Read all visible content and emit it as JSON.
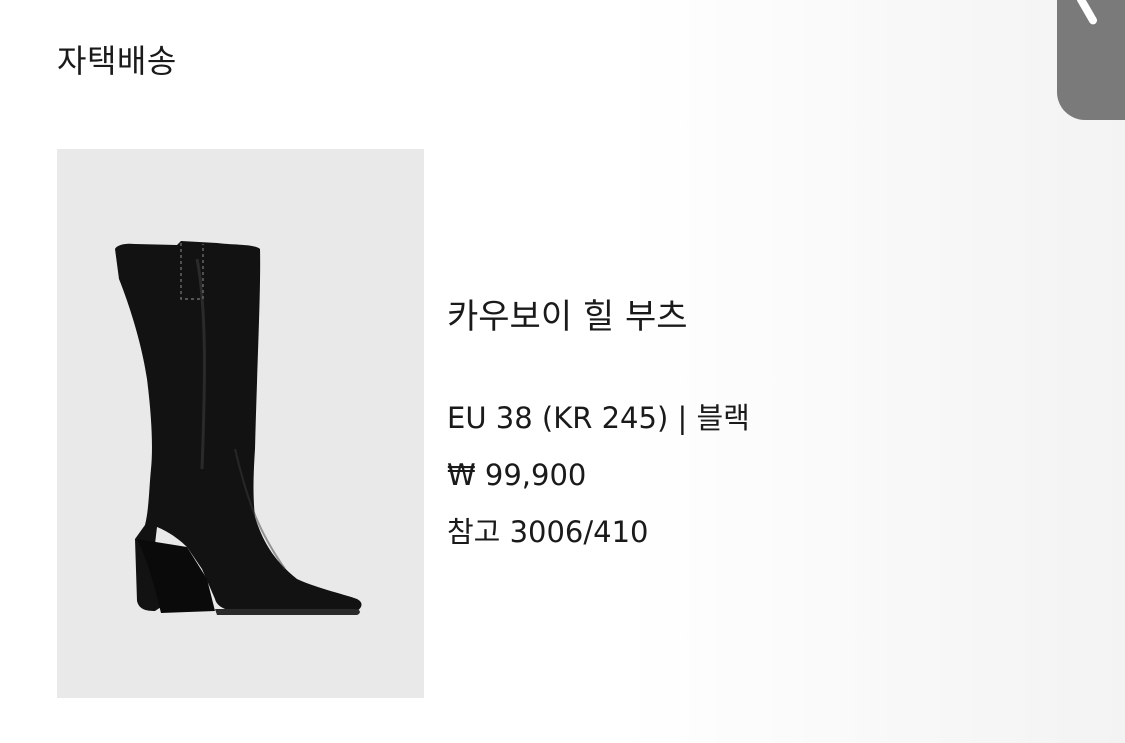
{
  "header": {
    "title": "자택배송"
  },
  "product": {
    "image_alt": "카우보이 힐 부츠",
    "name": "카우보이 힐 부츠",
    "size_color": "EU 38 (KR 245) | 블랙",
    "price": "₩ 99,900",
    "reference": "참고 3006/410"
  },
  "colors": {
    "image_background": "#e9e9ea",
    "boot": "#111111",
    "handle": "#7a7a7a"
  }
}
